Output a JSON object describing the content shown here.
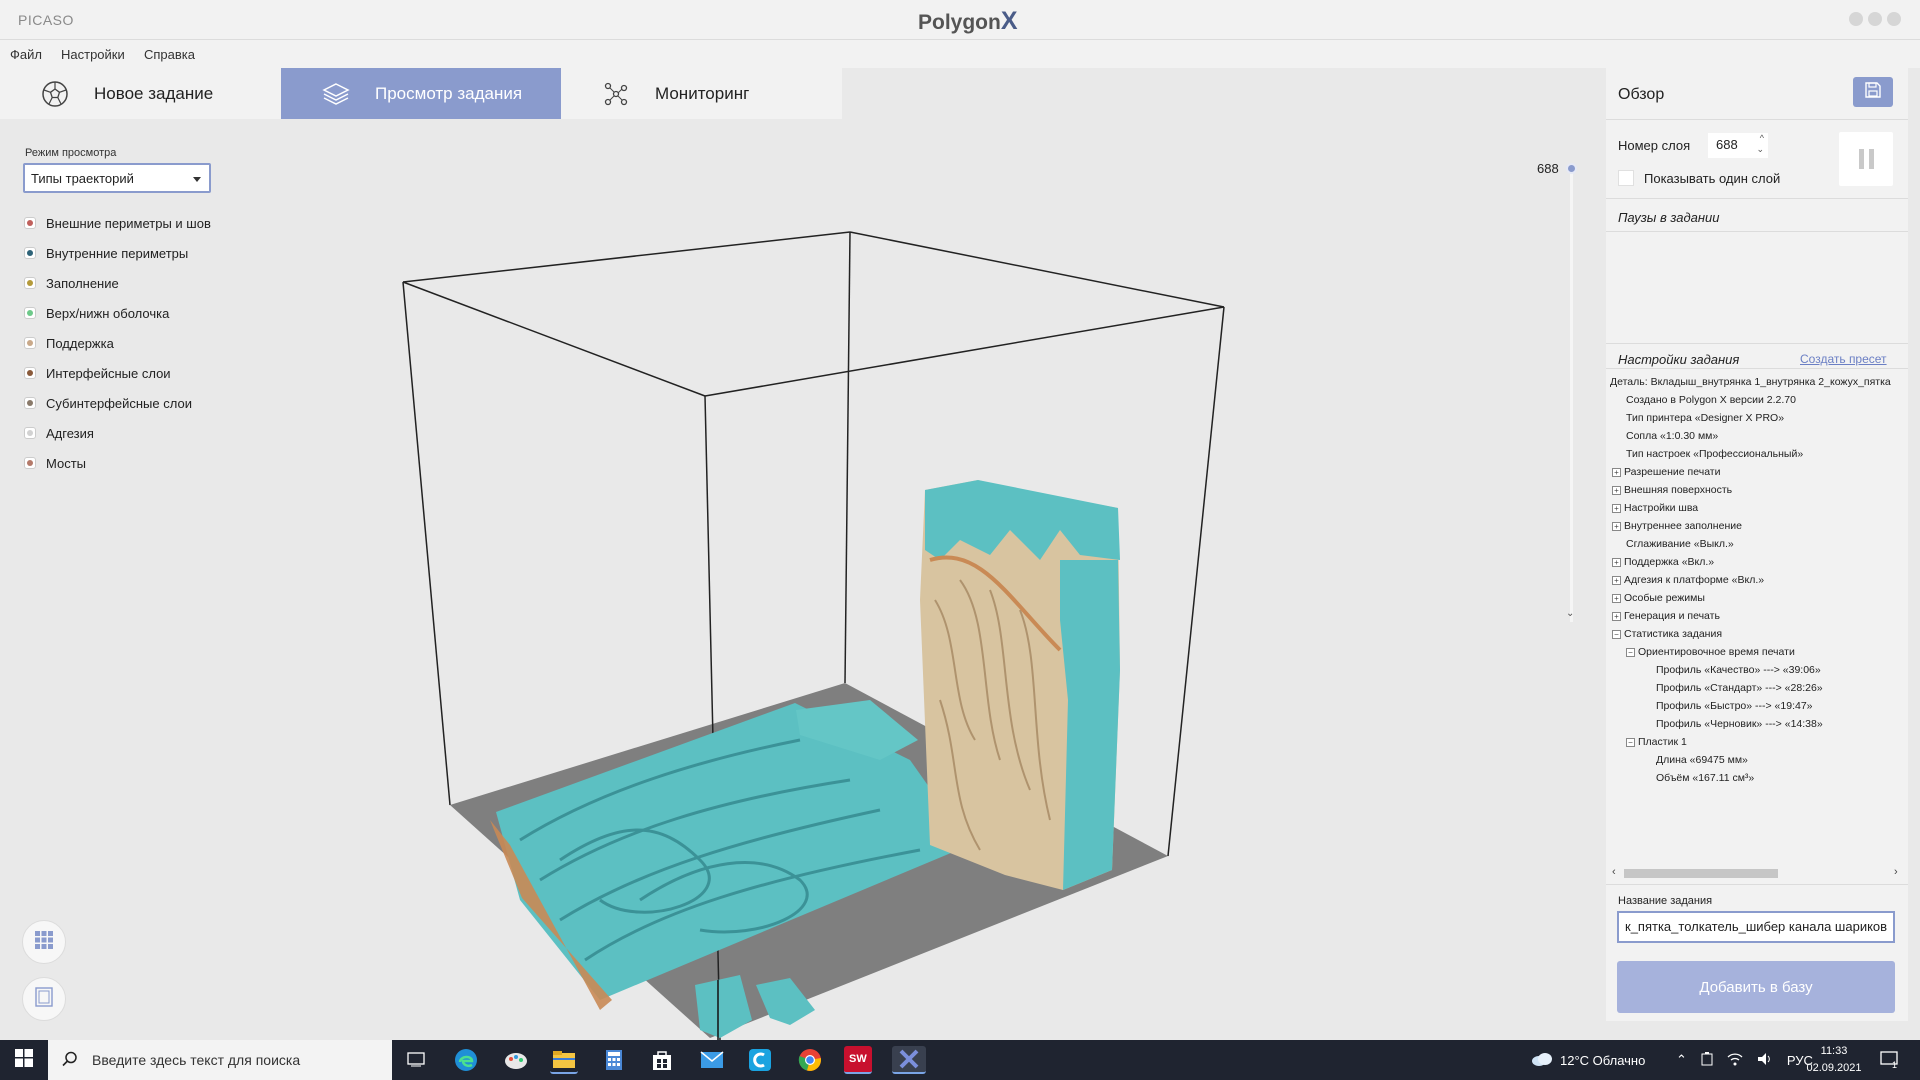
{
  "app": {
    "name": "PICASO",
    "brand": "Polygon",
    "brand_x": "X"
  },
  "menu": [
    "Файл",
    "Настройки",
    "Справка"
  ],
  "tabs": [
    {
      "label": "Новое задание",
      "icon": "soccer-ball-icon"
    },
    {
      "label": "Просмотр задания",
      "icon": "layers-icon",
      "active": true
    },
    {
      "label": "Мониторинг",
      "icon": "network-icon"
    }
  ],
  "view_mode": {
    "label": "Режим просмотра",
    "value": "Типы траекторий"
  },
  "legend": [
    {
      "label": "Внешние периметры и шов",
      "color": "#c0605c"
    },
    {
      "label": "Внутренние периметры",
      "color": "#2e6378"
    },
    {
      "label": "Заполнение",
      "color": "#b49a3a"
    },
    {
      "label": "Верх/нижн оболочка",
      "color": "#6ec98a"
    },
    {
      "label": "Поддержка",
      "color": "#c9a98a"
    },
    {
      "label": "Интерфейсные слои",
      "color": "#8a5a3a"
    },
    {
      "label": "Субинтерфейсные слои",
      "color": "#8a7a6a"
    },
    {
      "label": "Адгезия",
      "color": "#d2d2d2"
    },
    {
      "label": "Мосты",
      "color": "#b47a6a"
    }
  ],
  "layer_slider": {
    "value": "688"
  },
  "right_panel": {
    "title": "Обзор",
    "layer_label": "Номер слоя",
    "layer_value": "688",
    "single_layer_label": "Показывать один слой",
    "pauses_label": "Паузы в задании",
    "settings_label": "Настройки задания",
    "create_preset": "Создать пресет",
    "tree": [
      {
        "text": "Деталь: Вкладыш_внутрянка 1_внутрянка 2_кожух_пятка",
        "indent": 0,
        "pm": ""
      },
      {
        "text": "Создано в Polygon X версии  2.2.70",
        "indent": 1,
        "pm": ""
      },
      {
        "text": "Тип принтера «Designer X PRO»",
        "indent": 1,
        "pm": ""
      },
      {
        "text": "Сопла «1:0.30 мм»",
        "indent": 1,
        "pm": ""
      },
      {
        "text": "Тип настроек «Профессиональный»",
        "indent": 1,
        "pm": ""
      },
      {
        "text": "Разрешение печати",
        "indent": 1,
        "pm": "+"
      },
      {
        "text": "Внешняя поверхность",
        "indent": 1,
        "pm": "+"
      },
      {
        "text": "Настройки шва",
        "indent": 1,
        "pm": "+"
      },
      {
        "text": "Внутреннее заполнение",
        "indent": 1,
        "pm": "+"
      },
      {
        "text": "Сглаживание «Выкл.»",
        "indent": 1,
        "pm": ""
      },
      {
        "text": "Поддержка «Вкл.»",
        "indent": 1,
        "pm": "+"
      },
      {
        "text": "Адгезия к платформе «Вкл.»",
        "indent": 1,
        "pm": "+"
      },
      {
        "text": "Особые режимы",
        "indent": 1,
        "pm": "+"
      },
      {
        "text": "Генерация и печать",
        "indent": 1,
        "pm": "+"
      },
      {
        "text": "Статистика задания",
        "indent": 1,
        "pm": "−"
      },
      {
        "text": "Ориентировочное время печати",
        "indent": 2,
        "pm": "−"
      },
      {
        "text": "Профиль «Качество» ---> «39:06»",
        "indent": 3,
        "pm": ""
      },
      {
        "text": "Профиль «Стандарт» ---> «28:26»",
        "indent": 3,
        "pm": ""
      },
      {
        "text": "Профиль «Быстро» ---> «19:47»",
        "indent": 3,
        "pm": ""
      },
      {
        "text": "Профиль «Черновик» ---> «14:38»",
        "indent": 3,
        "pm": ""
      },
      {
        "text": "Пластик 1",
        "indent": 2,
        "pm": "−"
      },
      {
        "text": "Длина «69475 мм»",
        "indent": 3,
        "pm": ""
      },
      {
        "text": "Объём «167.11 см³»",
        "indent": 3,
        "pm": ""
      }
    ],
    "jobname_label": "Название задания",
    "jobname_value": "к_пятка_толкатель_шибер канала шариков",
    "add_button": "Добавить в базу"
  },
  "taskbar": {
    "search_placeholder": "Введите здесь текст для поиска",
    "weather": "12°C  Облачно",
    "lang": "РУС",
    "time": "11:33",
    "date": "02.09.2021",
    "notification_count": "1",
    "apps": [
      "task-view-icon",
      "edge-icon",
      "paint-icon",
      "file-explorer-icon",
      "calculator-icon",
      "store-icon",
      "mail-icon",
      "ccleaner-icon",
      "chrome-icon",
      "solidworks-icon",
      "polygonx-icon"
    ]
  },
  "colors": {
    "accent": "#8a9bcd",
    "teal": "#5fc1c4",
    "beige": "#d9c6a5",
    "bed": "#7a7a7a"
  }
}
